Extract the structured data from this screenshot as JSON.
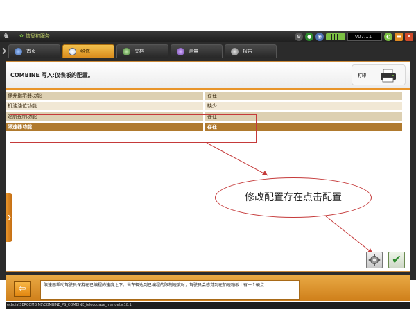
{
  "titlebar": {
    "app_title": "信息和服务",
    "version": "v07.11"
  },
  "tabs": [
    {
      "label": "首页",
      "icon": "globe-icon",
      "active": false
    },
    {
      "label": "维修",
      "icon": "magnifier-icon",
      "active": true
    },
    {
      "label": "文档",
      "icon": "document-icon",
      "active": false
    },
    {
      "label": "测量",
      "icon": "wave-icon",
      "active": false
    },
    {
      "label": "报告",
      "icon": "report-icon",
      "active": false
    }
  ],
  "panel": {
    "title": "COMBINE 写入:仪表板的配置。",
    "print_label": "打印"
  },
  "params": [
    {
      "name": "保养指示器功能",
      "value": "存在"
    },
    {
      "name": "机油油位功能",
      "value": "缺少"
    },
    {
      "name": "巡航控制功能",
      "value": "存在"
    },
    {
      "name": "限速器功能",
      "value": "存在"
    }
  ],
  "annotation": {
    "text": "修改配置存在点击配置"
  },
  "footer": {
    "message": "限速器帮助驾驶员保持在已编程的速度之下。当车辆达到已编程的限制速度时，驾驶员会感觉到在加速踏板上有一个硬点",
    "status_path": "ecbdia\\SERCOMBINE\\COMBINE_PS_COMBINE_telecodage_manuel.v.18.1"
  },
  "colors": {
    "accent_orange": "#e8942a",
    "selected_row": "#b07a2e",
    "annotation_red": "#c53a3a"
  }
}
